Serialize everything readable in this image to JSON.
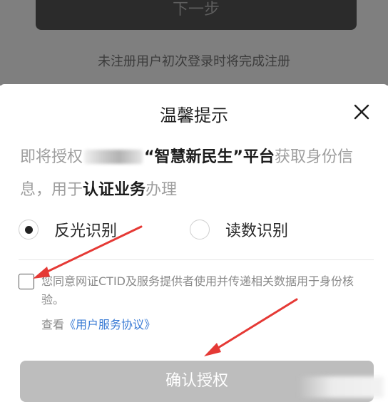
{
  "background": {
    "next_button": "下一步",
    "register_hint": "未注册用户初次登录时将完成注册"
  },
  "dialog": {
    "title": "温馨提示",
    "auth_prefix": "即将授权",
    "platform": "“智慧新民生”平台",
    "auth_mid": "获取身份信息，用于",
    "business": "认证业务",
    "auth_suffix": "办理",
    "options": [
      {
        "label": "反光识别",
        "selected": true
      },
      {
        "label": "读数识别",
        "selected": false
      }
    ],
    "consent": {
      "checked": false,
      "text": "您同意网证CTID及服务提供者使用并传递相关数据用于身份核验。",
      "view_prefix": "查看",
      "agreement_link": "《用户服务协议》"
    },
    "confirm_button": "确认授权"
  },
  "colors": {
    "annotation_arrow": "#e53935",
    "link": "#3a7bd5",
    "disabled_button": "#bdbdbd"
  }
}
